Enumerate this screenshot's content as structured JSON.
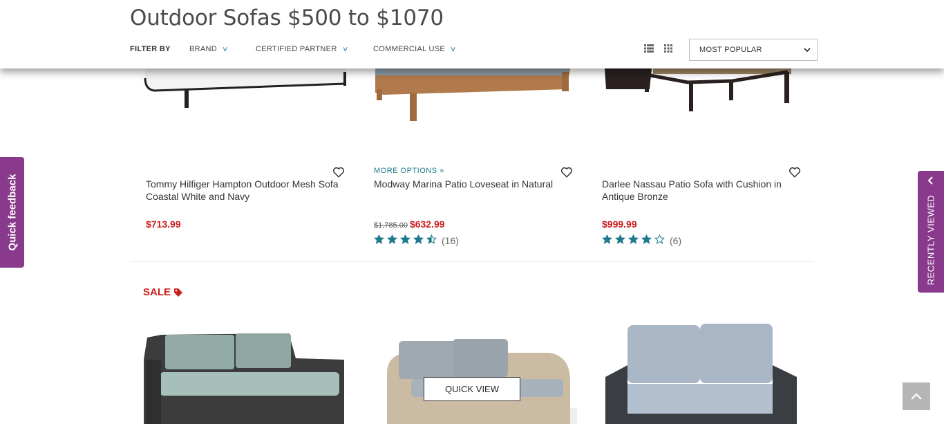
{
  "header": {
    "title": "Outdoor Sofas $500 to $1070",
    "filter_by": "FILTER BY",
    "filters": [
      {
        "label": "BRAND"
      },
      {
        "label": "CERTIFIED PARTNER"
      },
      {
        "label": "COMMERCIAL USE"
      }
    ],
    "view_icons": [
      "list-view-icon",
      "grid-view-icon"
    ],
    "sort": {
      "selected": "MOST POPULAR"
    }
  },
  "products": [
    {
      "name": "Tommy Hilfiger Hampton Outdoor Mesh Sofa Coastal White and Navy",
      "price": "$713.99",
      "old_price": "",
      "more_options": "",
      "rating": null,
      "reviews": ""
    },
    {
      "name": "Modway Marina Patio Loveseat in Natural",
      "price": "$632.99",
      "old_price": "$1,785.00",
      "more_options": "MORE OPTIONS »",
      "rating": 4.5,
      "reviews": "(16)"
    },
    {
      "name": "Darlee Nassau Patio Sofa with Cushion in Antique Bronze",
      "price": "$999.99",
      "old_price": "",
      "more_options": "",
      "rating": 4,
      "reviews": "(6)"
    }
  ],
  "sale_label": "SALE",
  "quick_view": "QUICK VIEW",
  "side_tabs": {
    "feedback": "Quick feedback",
    "recently_viewed": "RECENTLY VIEWED"
  },
  "colors": {
    "accent_teal": "#1e7a8c",
    "price_red": "#cc1f1f",
    "tab_purple": "#8a3a8c"
  }
}
